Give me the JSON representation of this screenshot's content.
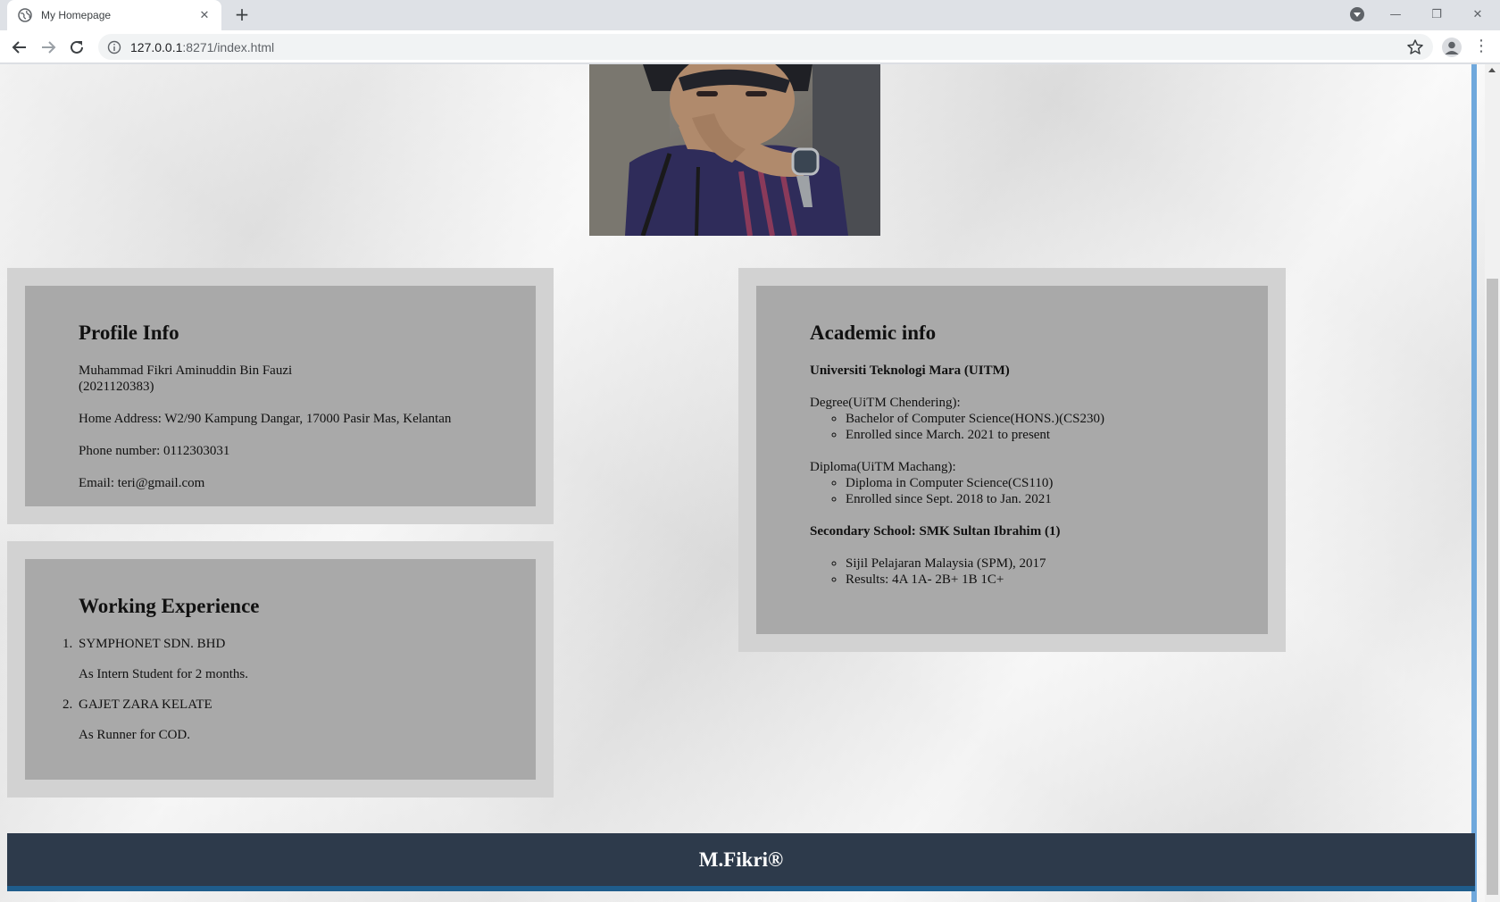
{
  "browser": {
    "tab_title": "My Homepage",
    "tab_close": "✕",
    "new_tab": "+",
    "url_host": "127.0.0.1",
    "url_rest": ":8271/index.html",
    "minimize": "—",
    "restore": "❐",
    "close": "✕",
    "menu": "⋮"
  },
  "profile": {
    "heading": "Profile Info",
    "name": "Muhammad Fikri Aminuddin Bin Fauzi",
    "student_id": "(2021120383)",
    "address": "Home Address: W2/90 Kampung Dangar, 17000 Pasir Mas, Kelantan",
    "phone": "Phone number: 0112303031",
    "email": "Email: teri@gmail.com"
  },
  "work": {
    "heading": "Working Experience",
    "items": [
      {
        "num": "1.",
        "company": "SYMPHONET SDN. BHD",
        "role": "As Intern Student for 2 months."
      },
      {
        "num": "2.",
        "company": "GAJET ZARA KELATE",
        "role": "As Runner for COD."
      }
    ]
  },
  "academic": {
    "heading": "Academic info",
    "university": "Universiti Teknologi Mara (UITM)",
    "degree_label": "Degree(UiTM Chendering):",
    "degree_items": [
      "Bachelor of Computer Science(HONS.)(CS230)",
      "Enrolled since March. 2021 to present"
    ],
    "diploma_label": "Diploma(UiTM Machang):",
    "diploma_items": [
      "Diploma in Computer Science(CS110)",
      "Enrolled since Sept. 2018 to Jan. 2021"
    ],
    "school": "Secondary School: SMK Sultan Ibrahim (1)",
    "school_items": [
      "Sijil Pelajaran Malaysia (SPM), 2017",
      "Results: 4A 1A- 2B+ 1B 1C+"
    ]
  },
  "footer": {
    "text": "M.Fikri®"
  }
}
